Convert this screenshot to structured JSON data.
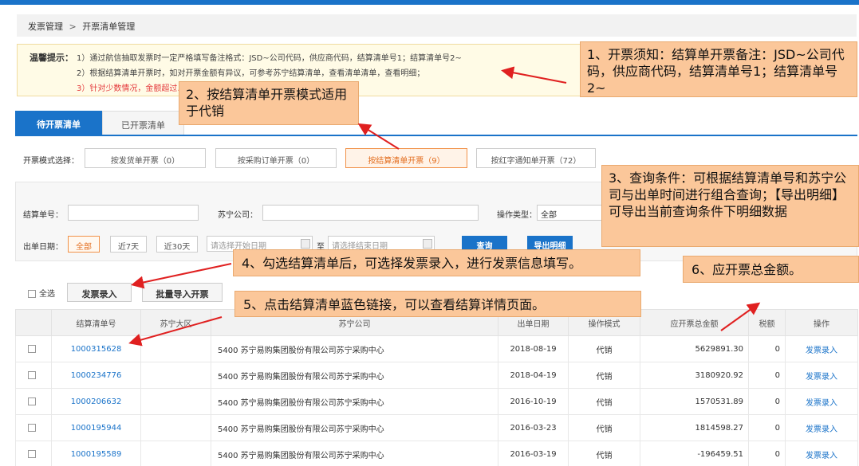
{
  "breadcrumb": {
    "root": "发票管理",
    "sep": ">",
    "current": "开票清单管理"
  },
  "notice": {
    "label": "温馨提示：",
    "lines": [
      "1）通过航信抽取发票时一定严格填写备注格式：JSD~公司代码，供应商代码，结算清单号1；结算清单号2~",
      "2）根据结算清单开票时，如对开票金额有异议，可参考苏宁结算清单，查看清单清单，查看明细；",
      "3）针对少数情况，金额超过……请在发票开具页面点击【增加发票】。"
    ]
  },
  "tabs": {
    "active": "待开票清单",
    "inactive": "已开票清单"
  },
  "mode": {
    "label": "开票模式选择：",
    "options": [
      "按发货单开票（0）",
      "按采购订单开票（0）",
      "按结算清单开票（9）",
      "按红字通知单开票（72）"
    ]
  },
  "filter": {
    "settlement_no_label": "结算单号：",
    "company_label": "苏宁公司：",
    "op_type_label": "操作类型：",
    "op_type_value": "全部",
    "date_label": "出单日期：",
    "date_options": [
      "全部",
      "近7天",
      "近30天"
    ],
    "start_placeholder": "请选择开始日期",
    "to": "至",
    "end_placeholder": "请选择结束日期",
    "query_button": "查询",
    "export_button": "导出明细"
  },
  "actions": {
    "select_all": "全选",
    "invoice_entry": "发票录入",
    "batch_import": "批量导入开票"
  },
  "table": {
    "headers": [
      "",
      "结算清单号",
      "苏宁大区",
      "苏宁公司",
      "出单日期",
      "操作模式",
      "应开票总金额",
      "税额",
      "操作"
    ],
    "rows": [
      {
        "no": "1000315628",
        "region": "",
        "company": "5400 苏宁易购集团股份有限公司苏宁采购中心",
        "date": "2018-08-19",
        "mode": "代销",
        "amount": "5629891.30",
        "tax": "0",
        "op": "发票录入"
      },
      {
        "no": "1000234776",
        "region": "",
        "company": "5400 苏宁易购集团股份有限公司苏宁采购中心",
        "date": "2018-04-19",
        "mode": "代销",
        "amount": "3180920.92",
        "tax": "0",
        "op": "发票录入"
      },
      {
        "no": "1000206632",
        "region": "",
        "company": "5400 苏宁易购集团股份有限公司苏宁采购中心",
        "date": "2016-10-19",
        "mode": "代销",
        "amount": "1570531.89",
        "tax": "0",
        "op": "发票录入"
      },
      {
        "no": "1000195944",
        "region": "",
        "company": "5400 苏宁易购集团股份有限公司苏宁采购中心",
        "date": "2016-03-23",
        "mode": "代销",
        "amount": "1814598.27",
        "tax": "0",
        "op": "发票录入"
      },
      {
        "no": "1000195589",
        "region": "",
        "company": "5400 苏宁易购集团股份有限公司苏宁采购中心",
        "date": "2016-03-19",
        "mode": "代销",
        "amount": "-196459.51",
        "tax": "0",
        "op": "发票录入"
      }
    ]
  },
  "callouts": {
    "c1": "1、开票须知：结算单开票备注：JSD~公司代码，供应商代码，结算清单号1；结算清单号2~",
    "c2": "2、按结算清单开票模式适用于代销",
    "c3": "3、查询条件：可根据结算清单号和苏宁公司与出单时间进行组合查询；【导出明细】可导出当前查询条件下明细数据",
    "c4": "4、勾选结算清单后，可选择发票录入，进行发票信息填写。",
    "c5": "5、点击结算清单蓝色链接，可以查看结算详情页面。",
    "c6": "6、应开票总金额。"
  },
  "colors": {
    "primary": "#1a73c9",
    "accent_orange": "#f19149",
    "callout_bg": "#fbc79a",
    "arrow_red": "#e02020",
    "notice_red": "#e4393c"
  }
}
